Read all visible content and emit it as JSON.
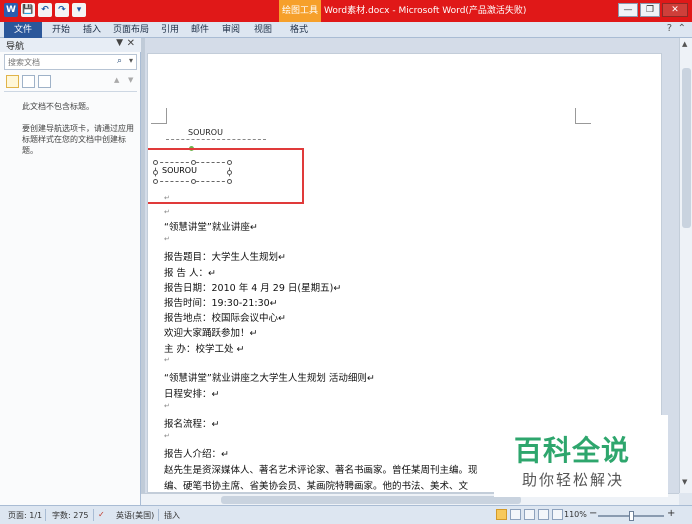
{
  "title_bar": {
    "context_tab": "绘图工具",
    "title": "Word素材.docx - Microsoft Word(产品激活失败)",
    "quick_access": [
      "W",
      "💾",
      "↶",
      "↷",
      "▾"
    ],
    "window_controls": [
      "—",
      "❐",
      "✕"
    ]
  },
  "ribbon": {
    "tabs": [
      "文件",
      "开始",
      "插入",
      "页面布局",
      "引用",
      "邮件",
      "审阅",
      "视图",
      "格式"
    ],
    "help": "?",
    "minimize": "⌃"
  },
  "nav_pane": {
    "title": "导航",
    "options_icon": "▼",
    "close_icon": "✕",
    "search_placeholder": "搜索文档",
    "no_headings_msg": "此文档不包含标题。",
    "create_nav_msg": "要创建导航选项卡，请通过应用标题样式在您的文档中创建标题。"
  },
  "document": {
    "header_text": "SOUROU",
    "textbox_text": "SOUROU",
    "lines": [
      {
        "text": "“领慧讲堂”就业讲座↵"
      },
      {
        "text": "报告题目：大学生人生规划↵"
      },
      {
        "text": "报  告  人：↵"
      },
      {
        "text": "报告日期：2010 年 4 月 29 日(星期五)↵"
      },
      {
        "text": "报告时间：19:30-21:30↵"
      },
      {
        "text": "报告地点：校国际会议中心↵"
      },
      {
        "text": "欢迎大家踊跃参加！↵"
      },
      {
        "text": "主  办：校学工处 ↵"
      },
      {
        "text": "“领慧讲堂”就业讲座之大学生人生规划 活动细则↵"
      },
      {
        "text": "日程安排：↵"
      },
      {
        "text": "报名流程：↵"
      },
      {
        "text": "报告人介绍：↵"
      },
      {
        "text": "赵先生是资深媒体人、著名艺术评论家、著名书画家。曾任某周刊主编。现"
      },
      {
        "text": "编、硬笔书协主席、省美协会员、某画院特聘画家。他的书法、美术、文"
      }
    ]
  },
  "status_bar": {
    "page": "页面: 1/1",
    "words": "字数: 275",
    "language": "英语(美国)",
    "mode": "插入",
    "zoom": "110%",
    "zoom_minus": "−",
    "zoom_plus": "+"
  },
  "watermark": {
    "line1": "百科全说",
    "line2": "助你轻松解决"
  },
  "colors": {
    "title_bar": "#e01818",
    "context_tab": "#f6a02b",
    "file_tab": "#2b579a",
    "annotation_box": "#e03a3a",
    "watermark_green": "#2ea66d"
  }
}
